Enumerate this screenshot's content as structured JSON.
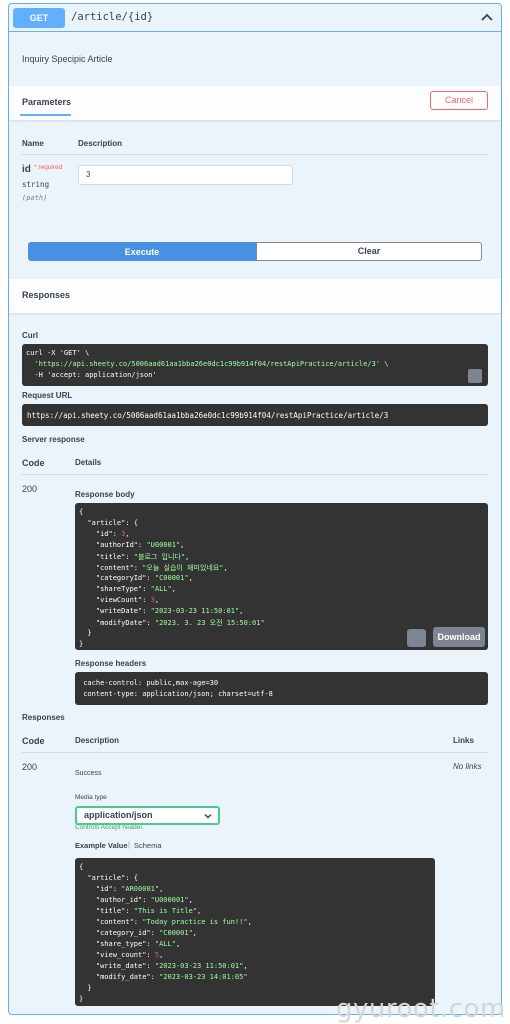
{
  "operation": {
    "method": "GET",
    "path": "/article/{id}",
    "description": "Inquiry Specipic Article"
  },
  "parameters": {
    "tab_label": "Parameters",
    "cancel_label": "Cancel",
    "col_name": "Name",
    "col_description": "Description",
    "param": {
      "name": "id",
      "required": "* required",
      "type": "string",
      "in": "(path)",
      "value": "3"
    },
    "execute_label": "Execute",
    "clear_label": "Clear"
  },
  "responses_header": "Responses",
  "curl": {
    "label": "Curl",
    "lines": [
      "curl -X 'GET' \\",
      "  'https://api.sheety.co/5006aad61aa1bba26e0dc1c99b914f04/restApiPractice/article/3' \\",
      "  -H 'accept: application/json'"
    ]
  },
  "request_url": {
    "label": "Request URL",
    "value": "https://api.sheety.co/5006aad61aa1bba26e0dc1c99b914f04/restApiPractice/article/3"
  },
  "server_response": {
    "label": "Server response",
    "col_code": "Code",
    "col_details": "Details",
    "code": "200",
    "body_label": "Response body",
    "body_lines": [
      "{",
      "  \"article\": {",
      "    \"id\": 3,",
      "    \"authorId\": \"U00001\",",
      "    \"title\": \"블로그 입니다\",",
      "    \"content\": \"오늘 실습이 재미있네요\",",
      "    \"categoryId\": \"C00001\",",
      "    \"shareType\": \"ALL\",",
      "    \"viewCount\": 3,",
      "    \"writeDate\": \"2023-03-23 11:50:01\",",
      "    \"modifyDate\": \"2023. 3. 23 오전 15:50:01\"",
      "  }",
      "}"
    ],
    "download_label": "Download",
    "headers_label": "Response headers",
    "headers_lines": [
      " cache-control: public,max-age=30",
      " content-type: application/json; charset=utf-8"
    ]
  },
  "responses": {
    "label": "Responses",
    "col_code": "Code",
    "col_description": "Description",
    "col_links": "Links",
    "code": "200",
    "description": "Success",
    "links": "No links",
    "media_type_label": "Media type",
    "media_type_value": "application/json",
    "controls_accept": "Controls Accept header.",
    "example_value_tab": "Example Value",
    "schema_tab": "Schema",
    "example_lines": [
      "{",
      "  \"article\": {",
      "    \"id\": \"AR00001\",",
      "    \"author_id\": \"U000001\",",
      "    \"title\": \"This is Title\",",
      "    \"content\": \"Today practice is fun!!\",",
      "    \"category_id\": \"C00001\",",
      "    \"share_type\": \"ALL\",",
      "    \"view_count\": 5,",
      "    \"write_date\": \"2023-03-23 11:50:01\",",
      "    \"modify_date\": \"2023-03-23 14:01:05\"",
      "  }",
      "}"
    ]
  },
  "watermark": "gyuroot.com",
  "colors": {
    "get_blue": "#61affe",
    "execute_blue": "#4990e2",
    "cancel_red": "#ff6060",
    "code_bg": "#333333",
    "string_green": "#a2fca2",
    "number_red": "#d36363",
    "media_green": "#49cc90"
  }
}
